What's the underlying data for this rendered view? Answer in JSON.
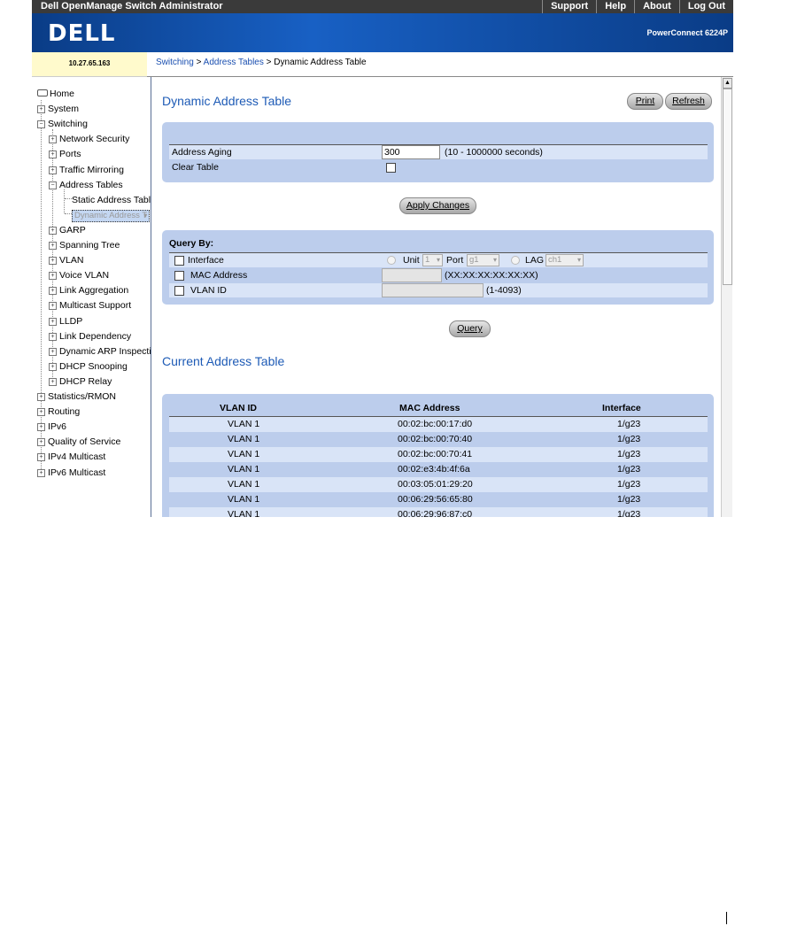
{
  "window": {
    "app_title": "Dell OpenManage Switch Administrator",
    "links": [
      "Support",
      "Help",
      "About",
      "Log Out"
    ]
  },
  "banner": {
    "logo": "DELL",
    "model": "PowerConnect 6224P"
  },
  "ip_address": "10.27.65.163",
  "breadcrumb": {
    "items": [
      "Switching",
      "Address Tables"
    ],
    "separator": " > ",
    "current": "Dynamic Address Table"
  },
  "sidebar": {
    "items": [
      {
        "label": "Home",
        "level": 0,
        "icon": "home-icon"
      },
      {
        "label": "System",
        "level": 0,
        "expander": "+"
      },
      {
        "label": "Switching",
        "level": 0,
        "expander": "-"
      },
      {
        "label": "Network Security",
        "level": 1,
        "expander": "+"
      },
      {
        "label": "Ports",
        "level": 1,
        "expander": "+"
      },
      {
        "label": "Traffic Mirroring",
        "level": 1,
        "expander": "+"
      },
      {
        "label": "Address Tables",
        "level": 1,
        "expander": "-"
      },
      {
        "label": "Static Address Tabl",
        "level": 2
      },
      {
        "label": "Dynamic Address T",
        "level": 2,
        "selected": true
      },
      {
        "label": "GARP",
        "level": 1,
        "expander": "+"
      },
      {
        "label": "Spanning Tree",
        "level": 1,
        "expander": "+"
      },
      {
        "label": "VLAN",
        "level": 1,
        "expander": "+"
      },
      {
        "label": "Voice VLAN",
        "level": 1,
        "expander": "+"
      },
      {
        "label": "Link Aggregation",
        "level": 1,
        "expander": "+"
      },
      {
        "label": "Multicast Support",
        "level": 1,
        "expander": "+"
      },
      {
        "label": "LLDP",
        "level": 1,
        "expander": "+"
      },
      {
        "label": "Link Dependency",
        "level": 1,
        "expander": "+"
      },
      {
        "label": "Dynamic ARP Inspecti",
        "level": 1,
        "expander": "+"
      },
      {
        "label": "DHCP Snooping",
        "level": 1,
        "expander": "+"
      },
      {
        "label": "DHCP Relay",
        "level": 1,
        "expander": "+"
      },
      {
        "label": "Statistics/RMON",
        "level": 0,
        "expander": "+"
      },
      {
        "label": "Routing",
        "level": 0,
        "expander": "+"
      },
      {
        "label": "IPv6",
        "level": 0,
        "expander": "+"
      },
      {
        "label": "Quality of Service",
        "level": 0,
        "expander": "+"
      },
      {
        "label": "IPv4 Multicast",
        "level": 0,
        "expander": "+"
      },
      {
        "label": "IPv6 Multicast",
        "level": 0,
        "expander": "+"
      }
    ]
  },
  "page": {
    "title": "Dynamic Address Table",
    "print_label": "Print",
    "refresh_label": "Refresh"
  },
  "settings": {
    "aging_label": "Address Aging",
    "aging_value": "300",
    "aging_hint": "(10 - 1000000 seconds)",
    "clear_label": "Clear Table",
    "clear_checked": false,
    "apply_label": "Apply Changes"
  },
  "query": {
    "heading": "Query By:",
    "interface_label": "Interface",
    "unit_label": "Unit",
    "unit_value": "1",
    "port_label": "Port",
    "port_value": "g1",
    "lag_label": "LAG",
    "lag_value": "ch1",
    "mac_label": "MAC Address",
    "mac_hint": "(XX:XX:XX:XX:XX:XX)",
    "vlan_label": "VLAN ID",
    "vlan_hint": "(1-4093)",
    "query_label": "Query"
  },
  "table": {
    "title": "Current Address Table",
    "headers": [
      "VLAN ID",
      "MAC Address",
      "Interface"
    ],
    "rows": [
      [
        "VLAN 1",
        "00:02:bc:00:17:d0",
        "1/g23"
      ],
      [
        "VLAN 1",
        "00:02:bc:00:70:40",
        "1/g23"
      ],
      [
        "VLAN 1",
        "00:02:bc:00:70:41",
        "1/g23"
      ],
      [
        "VLAN 1",
        "00:02:e3:4b:4f:6a",
        "1/g23"
      ],
      [
        "VLAN 1",
        "00:03:05:01:29:20",
        "1/g23"
      ],
      [
        "VLAN 1",
        "00:06:29:56:65:80",
        "1/g23"
      ],
      [
        "VLAN 1",
        "00:06:29:96:87:c0",
        "1/g23"
      ]
    ]
  },
  "colors": {
    "brand_blue": "#1e5bb6",
    "panel": "#bccdec",
    "panel_alt_row": "#d9e4f7"
  }
}
